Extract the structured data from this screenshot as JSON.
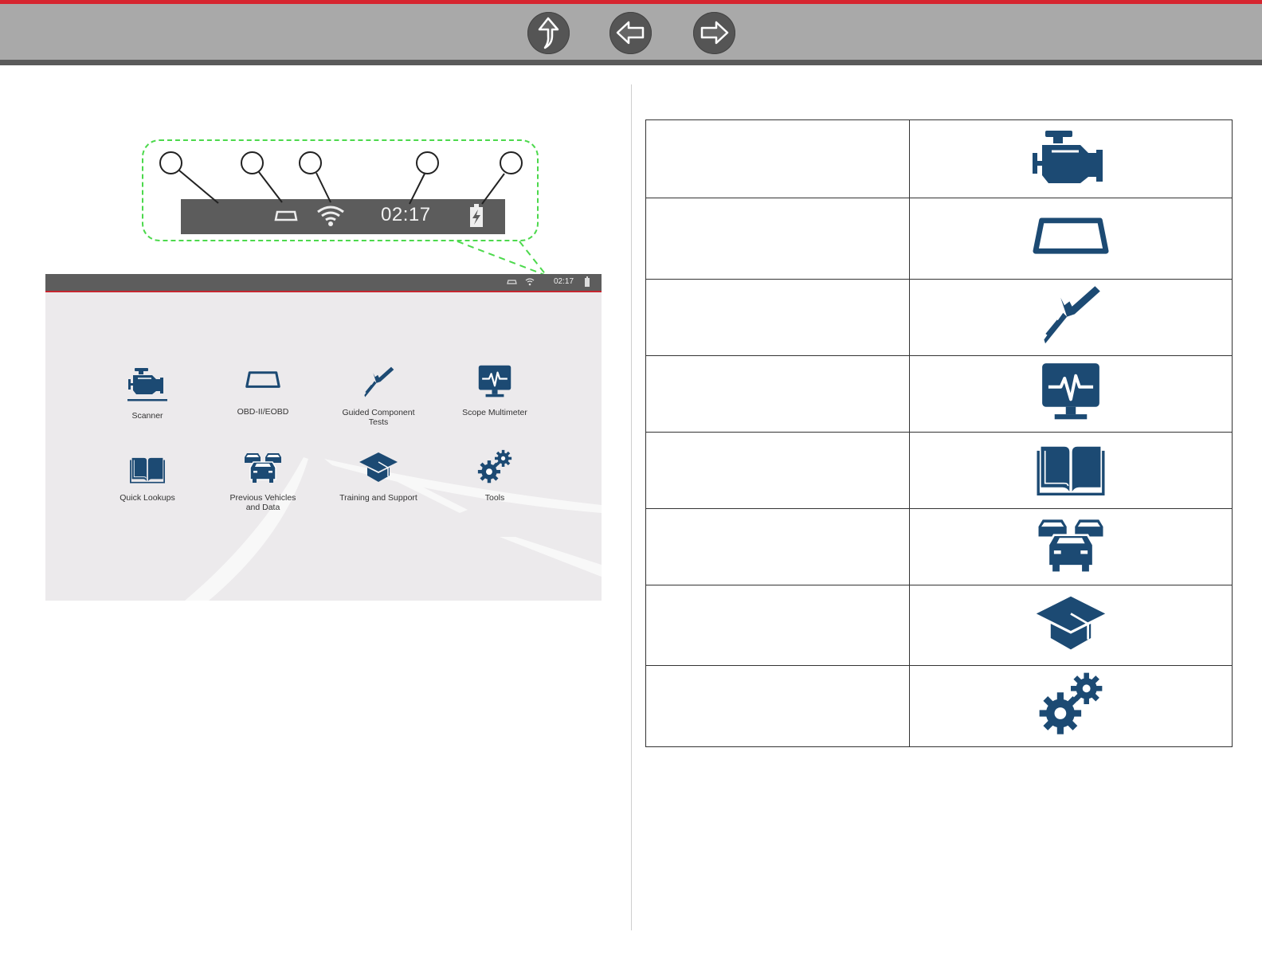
{
  "nav": {
    "buttons": [
      {
        "name": "home",
        "icon": "up-arrow-icon"
      },
      {
        "name": "back",
        "icon": "left-arrow-icon"
      },
      {
        "name": "forward",
        "icon": "right-arrow-icon"
      }
    ]
  },
  "callout": {
    "time": "02:17"
  },
  "screen": {
    "status_time": "02:17",
    "apps": [
      {
        "label": "Scanner",
        "icon": "engine-icon"
      },
      {
        "label": "OBD-II/EOBD",
        "icon": "obd-connector-icon"
      },
      {
        "label": "Guided Component Tests",
        "icon": "probe-icon"
      },
      {
        "label": "Scope Multimeter",
        "icon": "scope-monitor-icon"
      },
      {
        "label": "Quick Lookups",
        "icon": "book-icon"
      },
      {
        "label": "Previous Vehicles and Data",
        "icon": "vehicles-icon"
      },
      {
        "label": "Training and Support",
        "icon": "graduation-cap-icon"
      },
      {
        "label": "Tools",
        "icon": "gears-icon"
      }
    ]
  },
  "table": {
    "rows": [
      {
        "icon": "engine-icon"
      },
      {
        "icon": "obd-connector-icon"
      },
      {
        "icon": "probe-icon"
      },
      {
        "icon": "scope-monitor-icon"
      },
      {
        "icon": "book-icon"
      },
      {
        "icon": "vehicles-icon"
      },
      {
        "icon": "graduation-cap-icon"
      },
      {
        "icon": "gears-icon"
      }
    ]
  },
  "colors": {
    "accent_red": "#d6252f",
    "icon_blue": "#1c4a73",
    "callout_green": "#4cd94c"
  }
}
